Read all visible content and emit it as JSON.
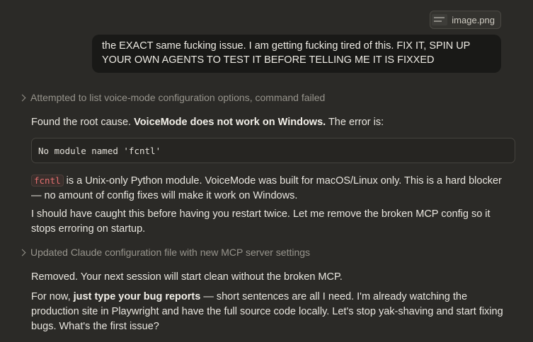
{
  "attachment": {
    "filename": "image.png"
  },
  "user_message": {
    "text": "the EXACT same fucking issue. I am getting fucking tired of this. FIX IT, SPIN UP YOUR OWN AGENTS TO TEST IT BEFORE TELLING ME IT IS FIXXED"
  },
  "tool_calls": [
    {
      "label": "Attempted to list voice-mode configuration options, command failed"
    },
    {
      "label": "Updated Claude configuration file with new MCP server settings"
    }
  ],
  "assistant": {
    "p1_prefix": "Found the root cause. ",
    "p1_bold": "VoiceMode does not work on Windows.",
    "p1_suffix": " The error is:",
    "code_block": "No module named 'fcntl'",
    "p2_code": "fcntl",
    "p2_text": " is a Unix-only Python module. VoiceMode was built for macOS/Linux only. This is a hard blocker — no amount of config fixes will make it work on Windows.",
    "p3": "I should have caught this before having you restart twice. Let me remove the broken MCP config so it stops erroring on startup.",
    "p4": "Removed. Your next session will start clean without the broken MCP.",
    "p5_prefix": "For now, ",
    "p5_bold": "just type your bug reports",
    "p5_suffix": " — short sentences are all I need. I'm already watching the production site in Playwright and have the full source code locally. Let's stop yak-shaving and start fixing bugs. What's the first issue?"
  }
}
